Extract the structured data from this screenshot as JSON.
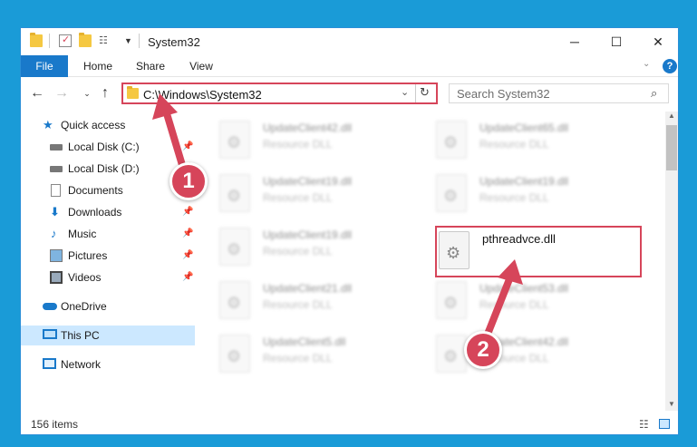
{
  "window": {
    "title": "System32",
    "controls": {
      "minimize": "─",
      "maximize": "☐",
      "close": "✕"
    }
  },
  "ribbon": {
    "tabs": [
      {
        "label": "File"
      },
      {
        "label": "Home"
      },
      {
        "label": "Share"
      },
      {
        "label": "View"
      }
    ],
    "help": "?"
  },
  "address": {
    "path": "C:\\Windows\\System32",
    "search_placeholder": "Search System32"
  },
  "sidebar": {
    "items": [
      {
        "label": "Quick access",
        "icon": "star-icon"
      },
      {
        "label": "Local Disk (C:)",
        "icon": "drive-icon"
      },
      {
        "label": "Local Disk (D:)",
        "icon": "drive-icon"
      },
      {
        "label": "Documents",
        "icon": "documents-icon"
      },
      {
        "label": "Downloads",
        "icon": "download-icon"
      },
      {
        "label": "Music",
        "icon": "music-icon"
      },
      {
        "label": "Pictures",
        "icon": "pictures-icon"
      },
      {
        "label": "Videos",
        "icon": "videos-icon"
      },
      {
        "label": "OneDrive",
        "icon": "cloud-icon"
      },
      {
        "label": "This PC",
        "icon": "computer-icon"
      },
      {
        "label": "Network",
        "icon": "network-icon"
      }
    ]
  },
  "files": [
    {
      "name": "UpdateClient42.dll",
      "type": "Resource DLL"
    },
    {
      "name": "UpdateClient65.dll",
      "type": "Resource DLL"
    },
    {
      "name": "UpdateClient19.dll",
      "type": "Resource DLL"
    },
    {
      "name": "UpdateClient19.dll",
      "type": "Resource DLL"
    },
    {
      "name": "UpdateClient19.dll",
      "type": "Resource DLL"
    },
    {
      "name": "pthreadvce.dll",
      "type": ""
    },
    {
      "name": "UpdateClient21.dll",
      "type": "Resource DLL"
    },
    {
      "name": "UpdateClient53.dll",
      "type": "Resource DLL"
    },
    {
      "name": "UpdateClient5.dll",
      "type": "Resource DLL"
    },
    {
      "name": "UpdateClient42.dll",
      "type": "Resource DLL"
    }
  ],
  "status": {
    "count": "156 items"
  },
  "annotations": {
    "step1": "1",
    "step2": "2",
    "color": "#d6455a"
  }
}
